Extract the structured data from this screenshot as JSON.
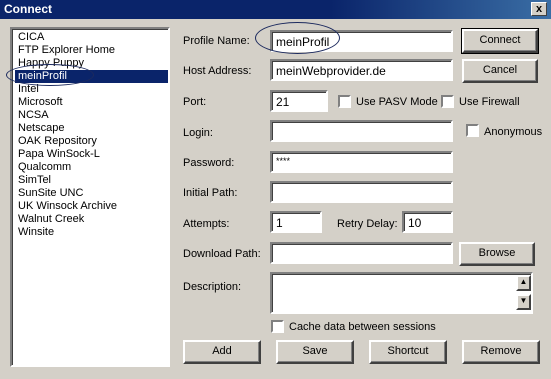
{
  "window": {
    "title": "Connect",
    "close_label": "x"
  },
  "profiles": [
    "CICA",
    "FTP Explorer Home",
    "Happy Puppy",
    "meinProfil",
    "Intel",
    "Microsoft",
    "NCSA",
    "Netscape",
    "OAK Repository",
    "Papa WinSock-L",
    "Qualcomm",
    "SimTel",
    "SunSite UNC",
    "UK Winsock Archive",
    "Walnut Creek",
    "Winsite"
  ],
  "selected_profile": "meinProfil",
  "form": {
    "profile_name_label": "Profile Name:",
    "profile_name_value": "meinProfil",
    "host_label": "Host Address:",
    "host_value": "meinWebprovider.de",
    "port_label": "Port:",
    "port_value": "21",
    "pasv_label": "Use PASV Mode",
    "firewall_label": "Use Firewall",
    "login_label": "Login:",
    "login_value": "",
    "anonymous_label": "Anonymous",
    "password_label": "Password:",
    "password_value": "****",
    "initial_path_label": "Initial Path:",
    "initial_path_value": "",
    "attempts_label": "Attempts:",
    "attempts_value": "1",
    "retry_label": "Retry Delay:",
    "retry_value": "10",
    "download_label": "Download Path:",
    "download_value": "",
    "description_label": "Description:",
    "description_value": "",
    "cache_label": "Cache data between sessions"
  },
  "buttons": {
    "connect": "Connect",
    "cancel": "Cancel",
    "browse": "Browse",
    "add": "Add",
    "save": "Save",
    "shortcut": "Shortcut",
    "remove": "Remove"
  }
}
